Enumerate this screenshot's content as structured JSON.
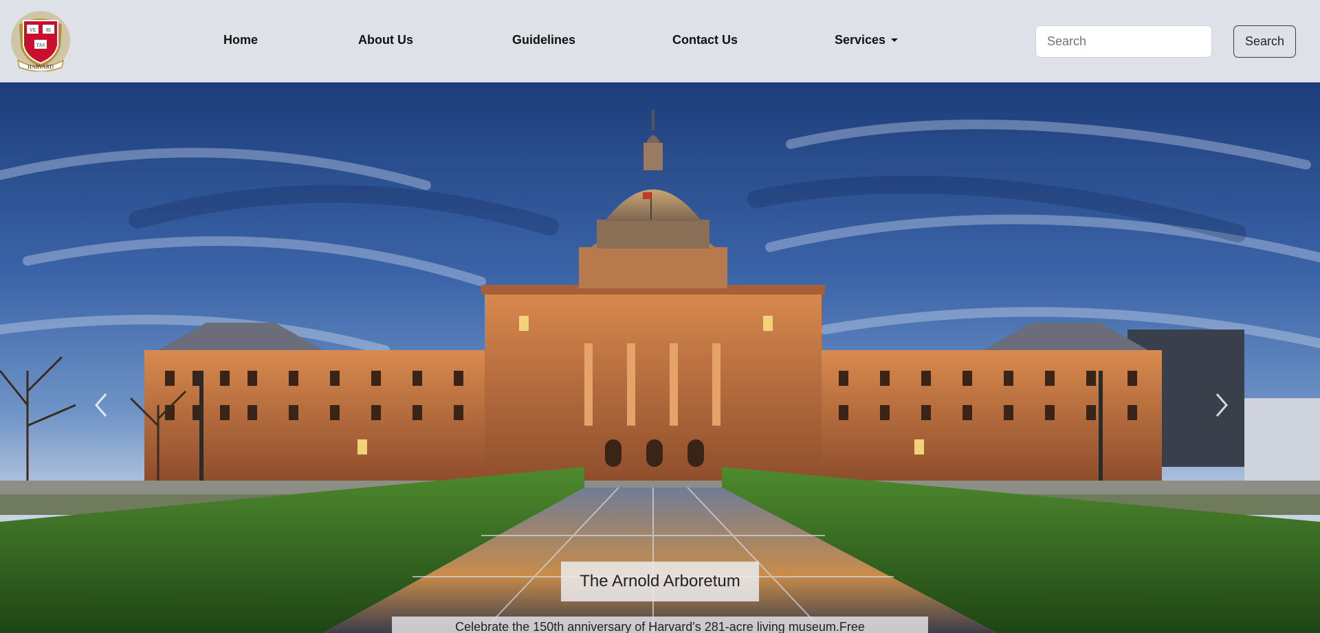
{
  "brand": {
    "logo_icon": "harvard-shield-icon",
    "logo_text": "HARVARD",
    "shield_text": [
      "VE",
      "RI",
      "TAS"
    ],
    "colors": {
      "crimson": "#c8102e",
      "gold": "#b8912f"
    }
  },
  "nav": {
    "items": [
      {
        "label": "Home"
      },
      {
        "label": "About Us"
      },
      {
        "label": "Guidelines"
      },
      {
        "label": "Contact Us"
      },
      {
        "label": "Services",
        "icon": "caret-down-icon"
      }
    ]
  },
  "search": {
    "placeholder": "Search",
    "button_label": "Search"
  },
  "carousel": {
    "prev_icon": "chevron-left-icon",
    "next_icon": "chevron-right-icon",
    "caption_title": "The Arnold Arboretum",
    "caption_text": "Celebrate the 150th anniversary of Harvard's 281-acre living museum.Free"
  }
}
